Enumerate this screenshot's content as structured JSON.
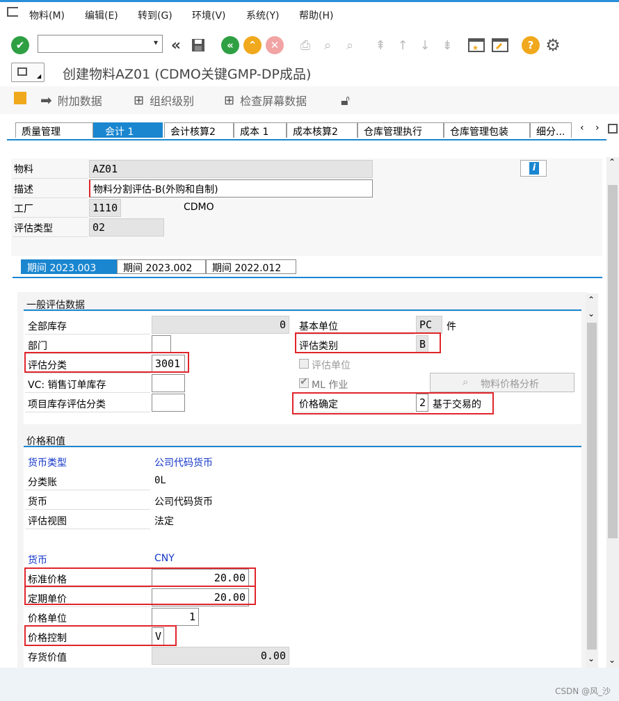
{
  "menu": {
    "items": [
      "物料(M)",
      "编辑(E)",
      "转到(G)",
      "环境(V)",
      "系统(Y)",
      "帮助(H)"
    ]
  },
  "toolbar": {
    "command_value": ""
  },
  "title": {
    "text": "创建物料AZ01 (CDMO关键GMP-DP成品)"
  },
  "app_toolbar": {
    "additional_data": "附加数据",
    "org_levels": "组织级别",
    "check_screen_data": "检查屏幕数据"
  },
  "tabs": [
    "质量管理",
    "会计 1",
    "会计核算2",
    "成本 1",
    "成本核算2",
    "仓库管理执行",
    "仓库管理包装",
    "细分..."
  ],
  "header": {
    "material_label": "物料",
    "material_value": "AZ01",
    "desc_label": "描述",
    "desc_value": "物料分割评估-B(外购和自制)",
    "plant_label": "工厂",
    "plant_value": "1110",
    "plant_name": "CDMO",
    "val_type_label": "评估类型",
    "val_type_value": "02"
  },
  "period_tabs": [
    "期间 2023.003",
    "期间 2023.002",
    "期间 2022.012"
  ],
  "general": {
    "section_title": "一般评估数据",
    "total_stock_label": "全部库存",
    "total_stock_value": "0",
    "division_label": "部门",
    "division_value": "",
    "val_class_label": "评估分类",
    "val_class_value": "3001",
    "vc_sales_label": "VC: 销售订单库存",
    "vc_sales_value": "",
    "proj_stock_label": "项目库存评估分类",
    "proj_stock_value": "",
    "base_unit_label": "基本单位",
    "base_unit_value": "PC",
    "base_unit_text": "件",
    "val_category_label": "评估类别",
    "val_category_value": "B",
    "val_unit_label": "评估单位",
    "ml_label": "ML 作业",
    "price_analysis_button": "物料价格分析",
    "price_det_label": "价格确定",
    "price_det_value": "2",
    "price_det_text": "基于交易的"
  },
  "prices": {
    "section_title": "价格和值",
    "currency_type_label": "货币类型",
    "currency_type_value": "公司代码货币",
    "ledger_label": "分类账",
    "ledger_value": "0L",
    "currency_label": "货币",
    "currency_value": "公司代码货币",
    "val_view_label": "评估视图",
    "val_view_value": "法定",
    "currency2_label": "货币",
    "currency2_value": "CNY",
    "std_price_label": "标准价格",
    "std_price_value": "20.00",
    "periodic_price_label": "定期单价",
    "periodic_price_value": "20.00",
    "price_unit_label": "价格单位",
    "price_unit_value": "1",
    "price_control_label": "价格控制",
    "price_control_value": "V",
    "inventory_value_label": "存货价值",
    "inventory_value_value": "0.00"
  },
  "watermark": "CSDN @风_沙",
  "colors": {
    "accent": "#1a86d0",
    "highlight_red": "#e0242a",
    "link_blue": "#1235c8"
  }
}
